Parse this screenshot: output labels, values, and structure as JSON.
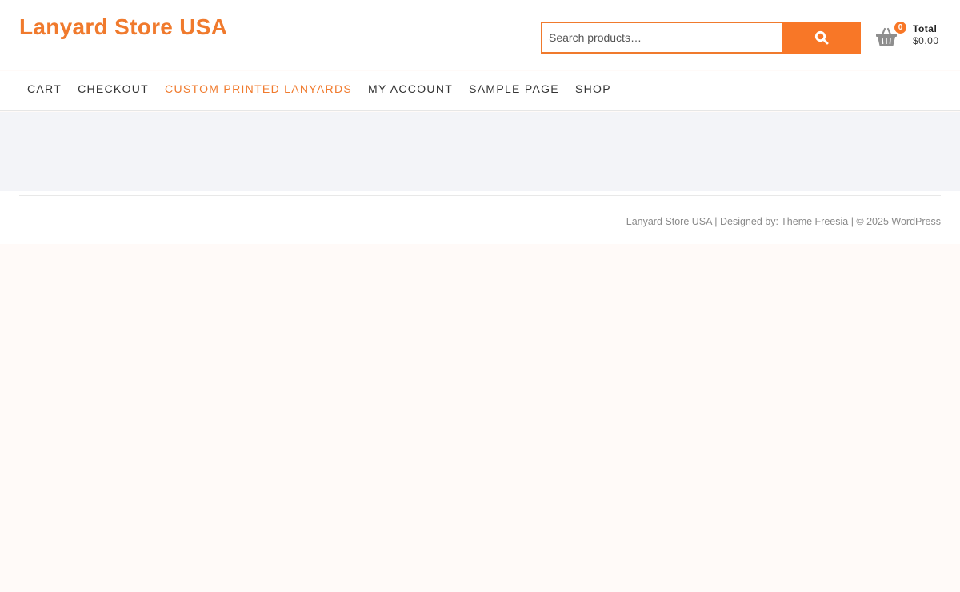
{
  "header": {
    "site_title": "Lanyard Store USA",
    "search": {
      "placeholder": "Search products…",
      "value": "",
      "button_icon": "search-icon"
    },
    "cart": {
      "icon": "basket-icon",
      "count": "0",
      "total_label": "Total",
      "total_amount": "$0.00"
    }
  },
  "nav": {
    "items": [
      {
        "label": "CART",
        "active": false
      },
      {
        "label": "CHECKOUT",
        "active": false
      },
      {
        "label": "CUSTOM PRINTED LANYARDS",
        "active": true
      },
      {
        "label": "MY ACCOUNT",
        "active": false
      },
      {
        "label": "SAMPLE PAGE",
        "active": false
      },
      {
        "label": "SHOP",
        "active": false
      }
    ]
  },
  "footer": {
    "site_link": "Lanyard Store USA",
    "sep1": " | Designed by: ",
    "theme_link": "Theme Freesia",
    "sep2": " | © 2025 ",
    "wp_link": "WordPress"
  },
  "colors": {
    "accent": "#f07a2d",
    "button": "#f87727",
    "band": "#f3f4f8",
    "page_bg": "#fffaf8"
  }
}
